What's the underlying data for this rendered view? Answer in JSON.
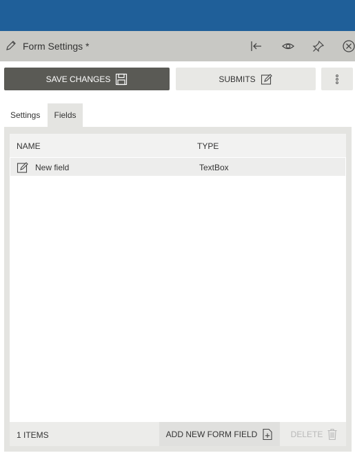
{
  "header": {
    "title": "Form Settings *",
    "icons": [
      "pencil-icon",
      "collapse-left-icon",
      "eye-icon",
      "pin-icon",
      "close-icon"
    ]
  },
  "toolbar": {
    "save_label": "SAVE CHANGES",
    "submits_label": "SUBMITS",
    "more_icon": "more-vertical-icon"
  },
  "tabs": [
    {
      "label": "Settings",
      "active": false
    },
    {
      "label": "Fields",
      "active": true
    }
  ],
  "grid": {
    "columns": [
      "NAME",
      "TYPE"
    ],
    "rows": [
      {
        "name": "New field",
        "type": "TextBox"
      }
    ],
    "footer": {
      "count": "1 ITEMS",
      "add_label": "ADD NEW FORM FIELD",
      "delete_label": "DELETE"
    }
  },
  "colors": {
    "topbar": "#1f5f99",
    "titlebar": "#c8c8c4",
    "save_button": "#5a5a55",
    "secondary_button": "#e8e8e5"
  }
}
